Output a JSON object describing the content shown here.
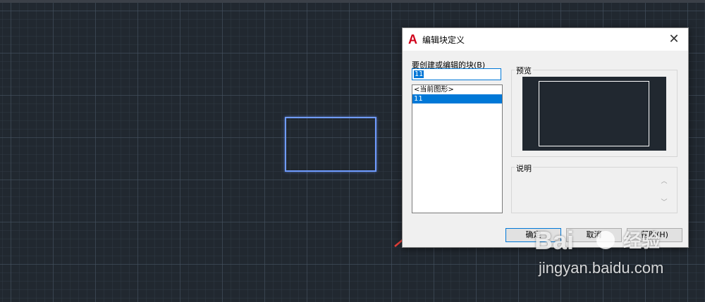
{
  "dialog": {
    "title": "编辑块定义",
    "close_label": "✕",
    "block_label": "要创建或编辑的块(B)",
    "block_name_value": "11",
    "block_list": [
      "<当前图形>",
      "11"
    ],
    "selected_block": "11",
    "preview_label": "预览",
    "description_label": "说明",
    "ok_label": "确定",
    "cancel_label": "取消",
    "help_label": "帮助(H)"
  },
  "watermark": {
    "brand": "Bai",
    "product": "经验",
    "url": "jingyan.baidu.com"
  },
  "colors": {
    "canvas_bg": "#212830",
    "cad_rect": "#6f9bff",
    "accent": "#0078d7",
    "arrow": "#e8403a"
  }
}
